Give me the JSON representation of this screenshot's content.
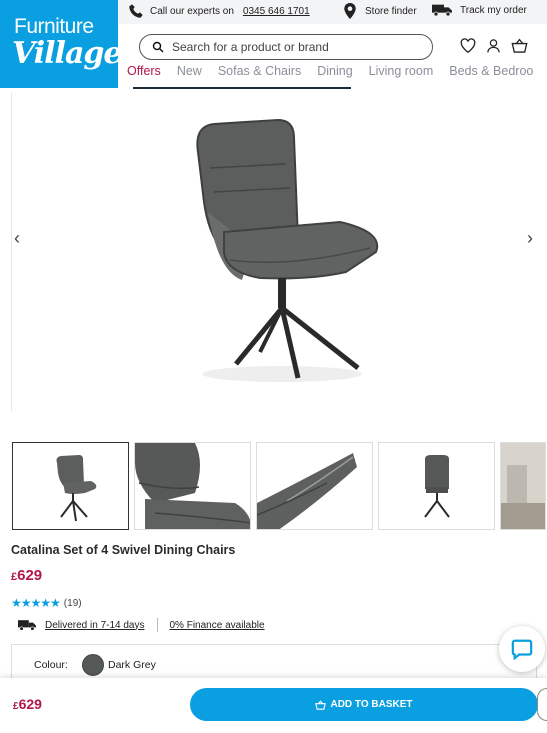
{
  "logo": {
    "line1": "Furniture",
    "line2": "Village"
  },
  "topbar": {
    "call_text": "Call our experts on",
    "phone": "0345 646 1701",
    "store_finder": "Store finder",
    "track_order": "Track my order"
  },
  "search": {
    "placeholder": "Search for a product or brand"
  },
  "nav": [
    "Offers",
    "New",
    "Sofas & Chairs",
    "Dining",
    "Living room",
    "Beds & Bedroo"
  ],
  "product": {
    "title": "Catalina Set of 4 Swivel Dining Chairs",
    "currency": "£",
    "price": "629",
    "review_count": "(19)",
    "rating_out_of_5": 5,
    "delivery": "Delivered in 7-14 days",
    "finance": "0% Finance available",
    "colour_label": "Colour:",
    "colour_value": "Dark Grey"
  },
  "sticky": {
    "currency": "£",
    "price": "629",
    "basket_label": "ADD TO BASKET"
  },
  "icons": [
    "phone-icon",
    "location-pin-icon",
    "delivery-truck-icon",
    "search-icon",
    "heart-icon",
    "user-icon",
    "basket-icon",
    "chevron-left-icon",
    "chevron-right-icon",
    "chat-icon"
  ],
  "colors": {
    "brand": "#0a9fe0",
    "price": "#b0174e",
    "star": "#0a9fe0",
    "swatch": "#565a57"
  }
}
